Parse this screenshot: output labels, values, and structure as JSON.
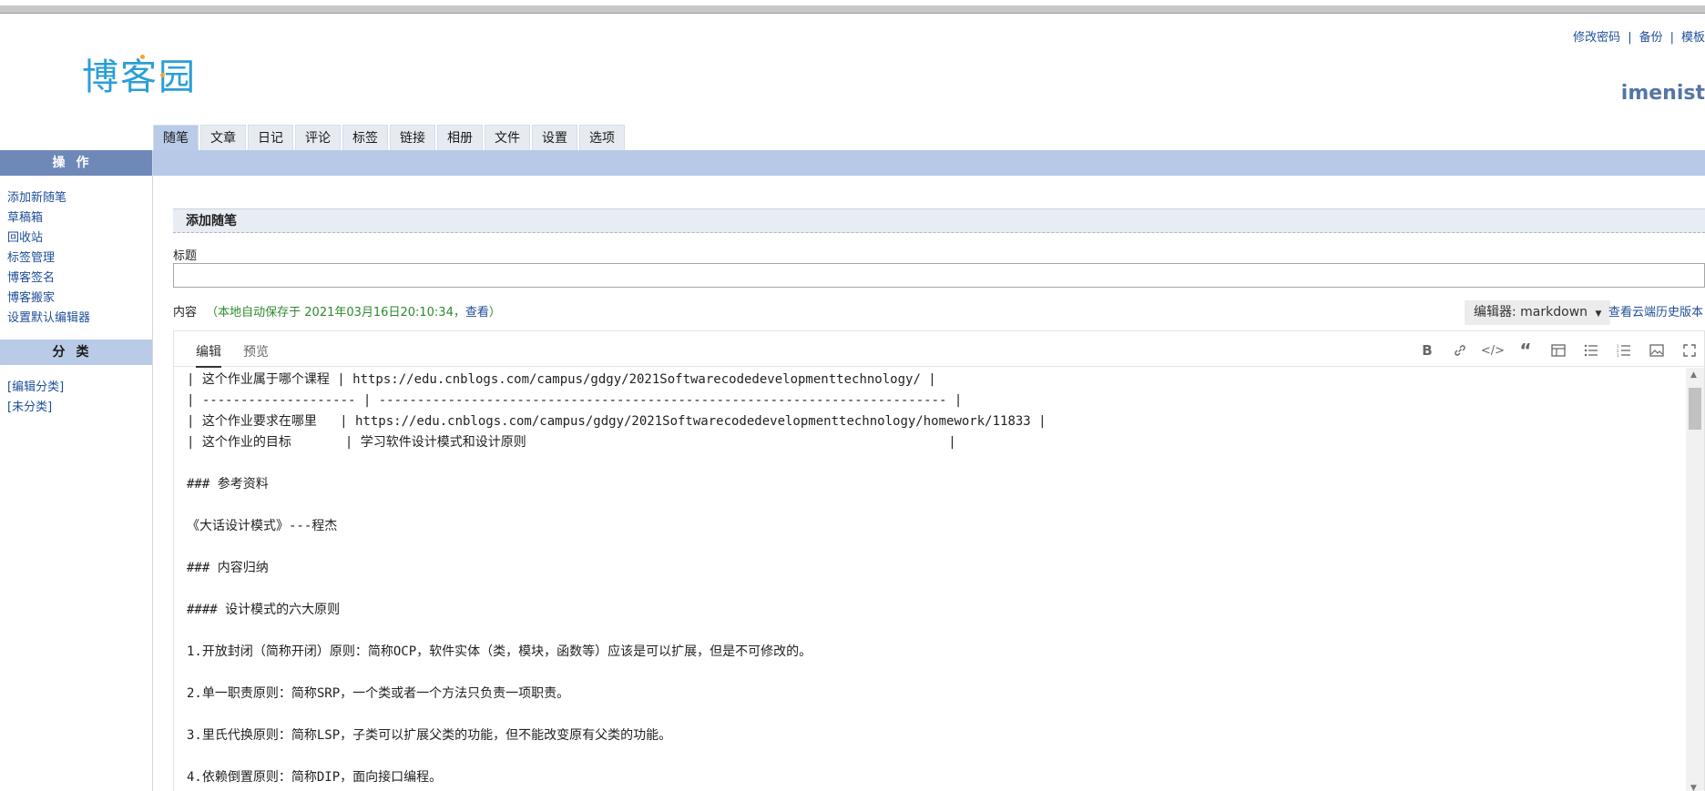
{
  "top_links": [
    "修改密码",
    "备份",
    "模板"
  ],
  "username": "imenist",
  "logo_text": "博客园",
  "tabs": [
    "随笔",
    "文章",
    "日记",
    "评论",
    "标签",
    "链接",
    "相册",
    "文件",
    "设置",
    "选项"
  ],
  "sidebar": {
    "operations_title": "操作",
    "operations": [
      "添加新随笔",
      "草稿箱",
      "回收站",
      "标签管理",
      "博客签名",
      "博客搬家",
      "设置默认编辑器"
    ],
    "category_title": "分类",
    "categories": [
      "[编辑分类]",
      "[未分类]"
    ]
  },
  "form": {
    "section_title": "添加随笔",
    "title_label": "标题",
    "title_value": "",
    "content_label": "内容",
    "autosave_text": "（本地自动保存于 2021年03月16日20:10:34，",
    "autosave_link": "查看",
    "autosave_close": "）",
    "editor_select": "编辑器: markdown",
    "cloud_history": "查看云端历史版本"
  },
  "editor": {
    "tabs": [
      "编辑",
      "预览"
    ],
    "tools": [
      "bold-icon",
      "link-icon",
      "code-icon",
      "quote-icon",
      "table-icon",
      "bullet-list-icon",
      "numbered-list-icon",
      "image-icon",
      "fullscreen-icon"
    ],
    "lines": [
      "| 这个作业属于哪个课程 | https://edu.cnblogs.com/campus/gdgy/2021Softwarecodedevelopmenttechnology/ |",
      "| -------------------- | -------------------------------------------------------------------------- |",
      "| 这个作业要求在哪里   | https://edu.cnblogs.com/campus/gdgy/2021Softwarecodedevelopmenttechnology/homework/11833 |",
      "| 这个作业的目标       | 学习软件设计模式和设计原则                                                       |",
      "",
      "### 参考资料",
      "",
      "《大话设计模式》---程杰",
      "",
      "### 内容归纳",
      "",
      "#### 设计模式的六大原则",
      "",
      "1.开放封闭（简称开闭）原则：简称OCP，软件实体（类，模块，函数等）应该是可以扩展，但是不可修改的。",
      "",
      "2.单一职责原则：简称SRP，一个类或者一个方法只负责一项职责。",
      "",
      "3.里氏代换原则：简称LSP，子类可以扩展父类的功能，但不能改变原有父类的功能。",
      "",
      "4.依赖倒置原则：简称DIP，面向接口编程。"
    ]
  },
  "colors": {
    "accent": "#2a9fd6",
    "sidebar_head": "#6e88b8",
    "bar": "#b7c9e6",
    "link": "#1f4e99",
    "autosave": "#2d8a2d"
  }
}
